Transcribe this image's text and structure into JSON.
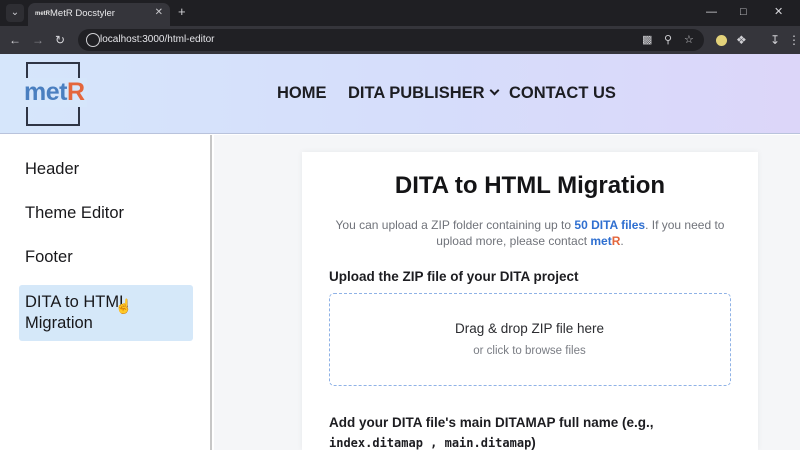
{
  "browser": {
    "tab_title": "MetR Docstyler",
    "favicon_text": "metR",
    "url": "localhost:3000/html-editor",
    "icons": [
      "tab-menu-icon",
      "close-icon",
      "new-tab-icon",
      "minimize-icon",
      "maximize-icon",
      "window-close-icon",
      "back-icon",
      "forward-icon",
      "reload-icon",
      "site-info-icon",
      "install-icon",
      "zoom-icon",
      "star-icon",
      "extension-icon",
      "puzzle-icon",
      "download-icon",
      "menu-icon"
    ]
  },
  "header": {
    "logo_main": "met",
    "logo_accent": "R",
    "nav": {
      "home": "HOME",
      "dita_publisher": "DITA PUBLISHER",
      "contact": "CONTACT US"
    }
  },
  "sidebar": {
    "items": [
      {
        "label": "Header"
      },
      {
        "label": "Theme Editor"
      },
      {
        "label": "Footer"
      },
      {
        "label": "DITA to HTML Migration",
        "active": true
      }
    ]
  },
  "main": {
    "title": "DITA to HTML Migration",
    "desc_part1": "You can upload a ZIP folder containing up to ",
    "desc_highlight": "50 DITA files",
    "desc_part2": ". If you need to upload more, please contact ",
    "desc_brand_m": "met",
    "desc_brand_r": "R",
    "desc_end": ".",
    "upload_label": "Upload the ZIP file of your DITA project",
    "dropzone_title": "Drag & drop ZIP file here",
    "dropzone_sub": "or click to browse files",
    "ditamap_label_part1": "Add your DITA file's main DITAMAP full name (e.g.,",
    "ditamap_example": "index.ditamap , main.ditamap",
    "ditamap_label_part2": ")"
  },
  "colors": {
    "accent": "#2f6fd0",
    "brand_orange": "#e4663c",
    "active_item_bg": "#d5e8f9"
  }
}
